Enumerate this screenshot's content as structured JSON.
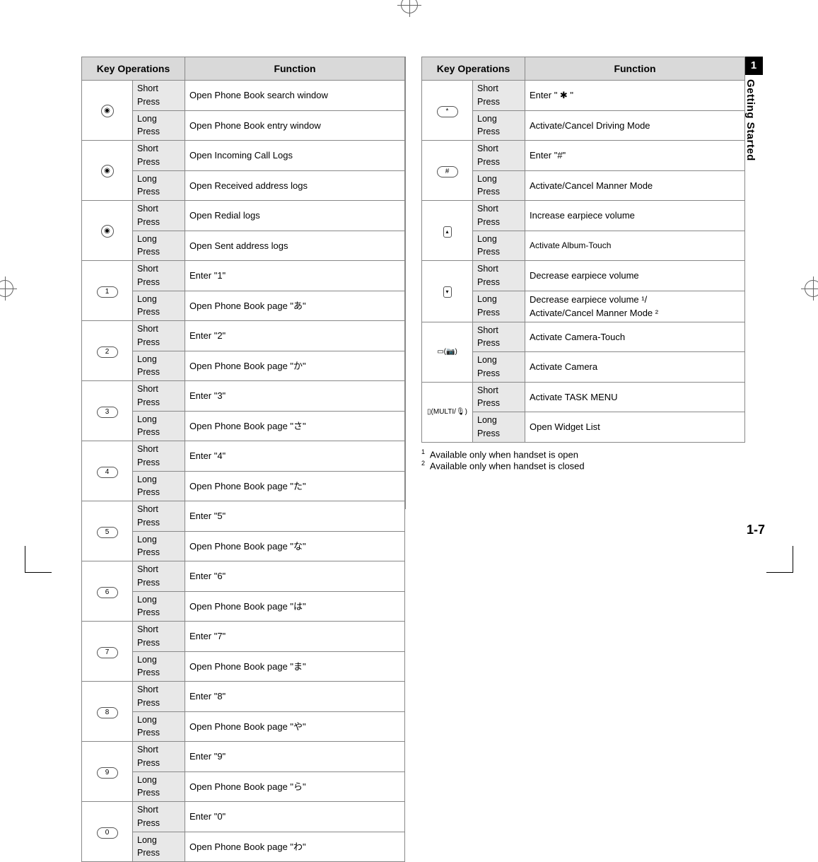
{
  "section": {
    "tab_number": "1",
    "title": "Getting Started",
    "page_number": "1-7"
  },
  "headers": {
    "key_ops": "Key Operations",
    "function": "Function",
    "short": "Short Press",
    "long": "Long Press"
  },
  "left_rows": [
    {
      "key": "nav-up",
      "glyph": "◉",
      "short": "Open Phone Book search window",
      "long": "Open Phone Book entry window"
    },
    {
      "key": "nav-left",
      "glyph": "◉",
      "short": "Open Incoming Call Logs",
      "long": "Open Received address logs"
    },
    {
      "key": "nav-right",
      "glyph": "◉",
      "short": "Open Redial logs",
      "long": "Open Sent address logs"
    },
    {
      "key": "key-1",
      "glyph": "1",
      "short": "Enter \"1\"",
      "long": "Open Phone Book page \"あ\""
    },
    {
      "key": "key-2",
      "glyph": "2",
      "short": "Enter \"2\"",
      "long": "Open Phone Book page \"か\""
    },
    {
      "key": "key-3",
      "glyph": "3",
      "short": "Enter \"3\"",
      "long": "Open Phone Book page \"さ\""
    },
    {
      "key": "key-4",
      "glyph": "4",
      "short": "Enter \"4\"",
      "long": "Open Phone Book page \"た\""
    },
    {
      "key": "key-5",
      "glyph": "5",
      "short": "Enter \"5\"",
      "long": "Open Phone Book page \"な\""
    },
    {
      "key": "key-6",
      "glyph": "6",
      "short": "Enter \"6\"",
      "long": "Open Phone Book page \"は\""
    },
    {
      "key": "key-7",
      "glyph": "7",
      "short": "Enter \"7\"",
      "long": "Open Phone Book page \"ま\""
    },
    {
      "key": "key-8",
      "glyph": "8",
      "short": "Enter \"8\"",
      "long": "Open Phone Book page \"や\""
    },
    {
      "key": "key-9",
      "glyph": "9",
      "short": "Enter \"9\"",
      "long": "Open Phone Book page \"ら\""
    },
    {
      "key": "key-0",
      "glyph": "0",
      "short": "Enter \"0\"",
      "long": "Open Phone Book page \"わ\""
    }
  ],
  "right_rows": [
    {
      "key": "key-star",
      "glyph": "*",
      "short": "Enter \" ✱ \"",
      "long": "Activate/Cancel Driving Mode",
      "style": "oval"
    },
    {
      "key": "key-hash",
      "glyph": "#",
      "short": "Enter \"#\"",
      "long": "Activate/Cancel Manner Mode",
      "style": "oval"
    },
    {
      "key": "key-vol-up",
      "glyph": "▴",
      "short": "Increase earpiece volume",
      "long": "Activate Album-Touch",
      "long_small": true,
      "style": "sq"
    },
    {
      "key": "key-vol-down",
      "glyph": "▾",
      "short": "Decrease earpiece volume",
      "long": "Decrease earpiece volume ¹/\nActivate/Cancel Manner Mode ²",
      "style": "sq",
      "tall": true
    },
    {
      "key": "key-camera",
      "glyph": "▭(📷)",
      "short": "Activate Camera-Touch",
      "long": "Activate Camera",
      "style": "txt"
    },
    {
      "key": "key-multi",
      "glyph": "▯(MULTI/🎙)",
      "short": "Activate TASK MENU",
      "long": "Open Widget List",
      "style": "txt"
    }
  ],
  "footnotes": [
    {
      "mark": "1",
      "text": "Available only when handset is open"
    },
    {
      "mark": "2",
      "text": "Available only when handset is closed"
    }
  ]
}
